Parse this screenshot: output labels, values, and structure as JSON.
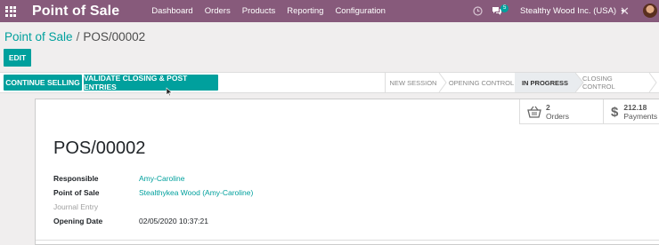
{
  "navbar": {
    "app_title": "Point of Sale",
    "menu": [
      "Dashboard",
      "Orders",
      "Products",
      "Reporting",
      "Configuration"
    ],
    "messages_count": "5",
    "company": "Stealthy Wood Inc. (USA)",
    "bg_color": "#875a7b"
  },
  "breadcrumb": {
    "parent": "Point of Sale",
    "separator": "/",
    "current": "POS/00002"
  },
  "actions": {
    "edit": "EDIT",
    "continue_selling": "CONTINUE SELLING",
    "validate": "VALIDATE CLOSING & POST ENTRIES"
  },
  "stages": [
    {
      "label": "NEW SESSION",
      "active": false
    },
    {
      "label": "OPENING CONTROL",
      "active": false
    },
    {
      "label": "IN PROGRESS",
      "active": true
    },
    {
      "label": "CLOSING CONTROL",
      "active": false
    }
  ],
  "stats": {
    "orders_value": "2",
    "orders_label": "Orders",
    "payments_value": "212.18",
    "payments_label": "Payments"
  },
  "record": {
    "title": "POS/00002",
    "fields": [
      {
        "label": "Responsible",
        "value": "Amy-Caroline"
      },
      {
        "label": "Point of Sale",
        "value": "Stealthykea Wood (Amy-Caroline)"
      },
      {
        "label": "Journal Entry",
        "value": ""
      },
      {
        "label": "Opening Date",
        "value": "02/05/2020 10:37:21"
      }
    ]
  },
  "colors": {
    "accent": "#00a09d",
    "brand": "#875a7b"
  }
}
